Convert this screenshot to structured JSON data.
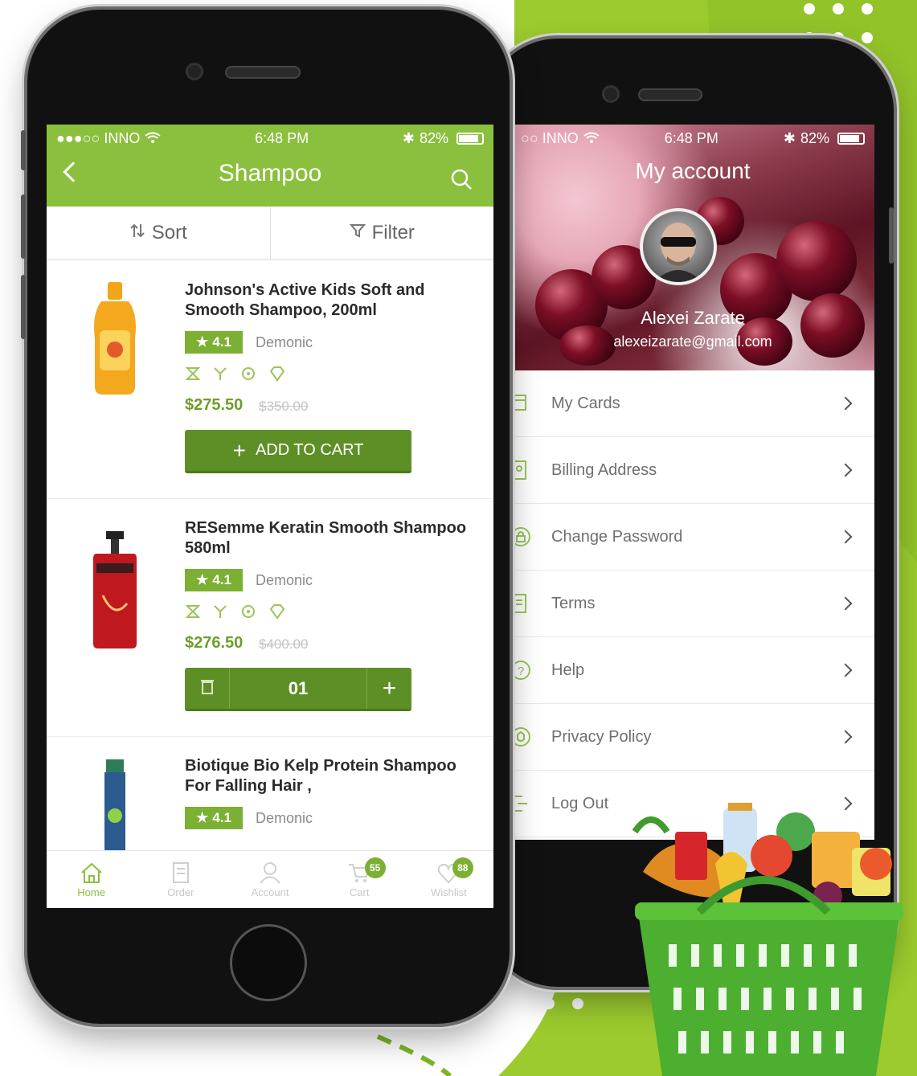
{
  "left_phone": {
    "status": {
      "carrier": "●●●○○ INNO",
      "time": "6:48 PM",
      "battery": "82%"
    },
    "header": {
      "title": "Shampoo"
    },
    "sortbar": {
      "sort_label": "Sort",
      "filter_label": "Filter"
    },
    "products": [
      {
        "name": "Johnson's Active Kids Soft and Smooth Shampoo, 200ml",
        "rating": "4.1",
        "brand": "Demonic",
        "price": "$275.50",
        "old_price": "$350.00",
        "action": "ADD TO CART"
      },
      {
        "name": "RESemme Keratin Smooth Shampoo 580ml",
        "rating": "4.1",
        "brand": "Demonic",
        "price": "$276.50",
        "old_price": "$400.00",
        "quantity": "01"
      },
      {
        "name": "Biotique Bio Kelp Protein Shampoo For Falling Hair ,",
        "rating": "4.1",
        "brand": "Demonic"
      }
    ],
    "bottom_nav": {
      "home": "Home",
      "order": "Order",
      "account": "Account",
      "cart": "Cart",
      "cart_badge": "55",
      "wishlist": "Wishlist",
      "wishlist_badge": "88"
    }
  },
  "right_phone": {
    "status": {
      "carrier": "○○ INNO",
      "time": "6:48 PM",
      "battery": "82%"
    },
    "header": {
      "title": "My account"
    },
    "profile": {
      "name": "Alexei Zarate",
      "email": "alexeizarate@gmail.com"
    },
    "menu": [
      {
        "label": "My Cards",
        "icon": "card-icon"
      },
      {
        "label": "Billing Address",
        "icon": "billing-icon"
      },
      {
        "label": "Change Password",
        "icon": "lock-icon"
      },
      {
        "label": "Terms",
        "icon": "terms-icon"
      },
      {
        "label": "Help",
        "icon": "help-icon"
      },
      {
        "label": "Privacy Policy",
        "icon": "privacy-icon"
      },
      {
        "label": "Log Out",
        "icon": "logout-icon"
      }
    ]
  },
  "colors": {
    "brand_green": "#8bbf3e",
    "button_green": "#5e8f26",
    "price_green": "#6c9e2a"
  }
}
